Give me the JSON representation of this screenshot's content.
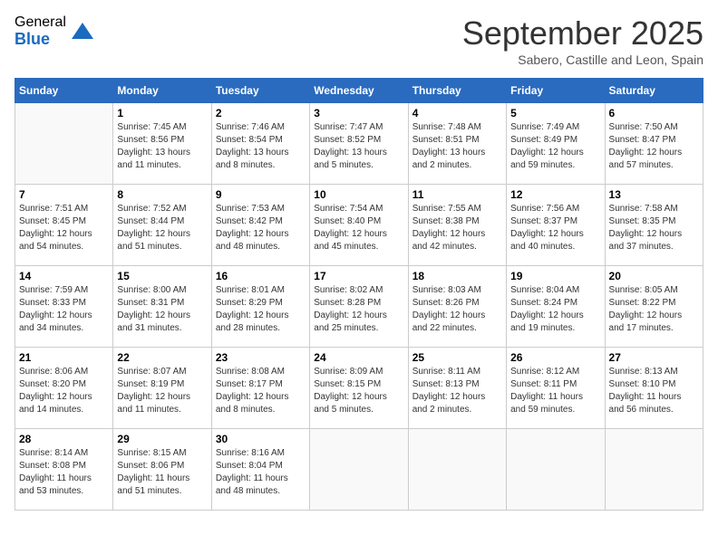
{
  "logo": {
    "general": "General",
    "blue": "Blue"
  },
  "title": "September 2025",
  "subtitle": "Sabero, Castille and Leon, Spain",
  "days_of_week": [
    "Sunday",
    "Monday",
    "Tuesday",
    "Wednesday",
    "Thursday",
    "Friday",
    "Saturday"
  ],
  "weeks": [
    [
      {
        "day": "",
        "info": ""
      },
      {
        "day": "1",
        "info": "Sunrise: 7:45 AM\nSunset: 8:56 PM\nDaylight: 13 hours\nand 11 minutes."
      },
      {
        "day": "2",
        "info": "Sunrise: 7:46 AM\nSunset: 8:54 PM\nDaylight: 13 hours\nand 8 minutes."
      },
      {
        "day": "3",
        "info": "Sunrise: 7:47 AM\nSunset: 8:52 PM\nDaylight: 13 hours\nand 5 minutes."
      },
      {
        "day": "4",
        "info": "Sunrise: 7:48 AM\nSunset: 8:51 PM\nDaylight: 13 hours\nand 2 minutes."
      },
      {
        "day": "5",
        "info": "Sunrise: 7:49 AM\nSunset: 8:49 PM\nDaylight: 12 hours\nand 59 minutes."
      },
      {
        "day": "6",
        "info": "Sunrise: 7:50 AM\nSunset: 8:47 PM\nDaylight: 12 hours\nand 57 minutes."
      }
    ],
    [
      {
        "day": "7",
        "info": "Sunrise: 7:51 AM\nSunset: 8:45 PM\nDaylight: 12 hours\nand 54 minutes."
      },
      {
        "day": "8",
        "info": "Sunrise: 7:52 AM\nSunset: 8:44 PM\nDaylight: 12 hours\nand 51 minutes."
      },
      {
        "day": "9",
        "info": "Sunrise: 7:53 AM\nSunset: 8:42 PM\nDaylight: 12 hours\nand 48 minutes."
      },
      {
        "day": "10",
        "info": "Sunrise: 7:54 AM\nSunset: 8:40 PM\nDaylight: 12 hours\nand 45 minutes."
      },
      {
        "day": "11",
        "info": "Sunrise: 7:55 AM\nSunset: 8:38 PM\nDaylight: 12 hours\nand 42 minutes."
      },
      {
        "day": "12",
        "info": "Sunrise: 7:56 AM\nSunset: 8:37 PM\nDaylight: 12 hours\nand 40 minutes."
      },
      {
        "day": "13",
        "info": "Sunrise: 7:58 AM\nSunset: 8:35 PM\nDaylight: 12 hours\nand 37 minutes."
      }
    ],
    [
      {
        "day": "14",
        "info": "Sunrise: 7:59 AM\nSunset: 8:33 PM\nDaylight: 12 hours\nand 34 minutes."
      },
      {
        "day": "15",
        "info": "Sunrise: 8:00 AM\nSunset: 8:31 PM\nDaylight: 12 hours\nand 31 minutes."
      },
      {
        "day": "16",
        "info": "Sunrise: 8:01 AM\nSunset: 8:29 PM\nDaylight: 12 hours\nand 28 minutes."
      },
      {
        "day": "17",
        "info": "Sunrise: 8:02 AM\nSunset: 8:28 PM\nDaylight: 12 hours\nand 25 minutes."
      },
      {
        "day": "18",
        "info": "Sunrise: 8:03 AM\nSunset: 8:26 PM\nDaylight: 12 hours\nand 22 minutes."
      },
      {
        "day": "19",
        "info": "Sunrise: 8:04 AM\nSunset: 8:24 PM\nDaylight: 12 hours\nand 19 minutes."
      },
      {
        "day": "20",
        "info": "Sunrise: 8:05 AM\nSunset: 8:22 PM\nDaylight: 12 hours\nand 17 minutes."
      }
    ],
    [
      {
        "day": "21",
        "info": "Sunrise: 8:06 AM\nSunset: 8:20 PM\nDaylight: 12 hours\nand 14 minutes."
      },
      {
        "day": "22",
        "info": "Sunrise: 8:07 AM\nSunset: 8:19 PM\nDaylight: 12 hours\nand 11 minutes."
      },
      {
        "day": "23",
        "info": "Sunrise: 8:08 AM\nSunset: 8:17 PM\nDaylight: 12 hours\nand 8 minutes."
      },
      {
        "day": "24",
        "info": "Sunrise: 8:09 AM\nSunset: 8:15 PM\nDaylight: 12 hours\nand 5 minutes."
      },
      {
        "day": "25",
        "info": "Sunrise: 8:11 AM\nSunset: 8:13 PM\nDaylight: 12 hours\nand 2 minutes."
      },
      {
        "day": "26",
        "info": "Sunrise: 8:12 AM\nSunset: 8:11 PM\nDaylight: 11 hours\nand 59 minutes."
      },
      {
        "day": "27",
        "info": "Sunrise: 8:13 AM\nSunset: 8:10 PM\nDaylight: 11 hours\nand 56 minutes."
      }
    ],
    [
      {
        "day": "28",
        "info": "Sunrise: 8:14 AM\nSunset: 8:08 PM\nDaylight: 11 hours\nand 53 minutes."
      },
      {
        "day": "29",
        "info": "Sunrise: 8:15 AM\nSunset: 8:06 PM\nDaylight: 11 hours\nand 51 minutes."
      },
      {
        "day": "30",
        "info": "Sunrise: 8:16 AM\nSunset: 8:04 PM\nDaylight: 11 hours\nand 48 minutes."
      },
      {
        "day": "",
        "info": ""
      },
      {
        "day": "",
        "info": ""
      },
      {
        "day": "",
        "info": ""
      },
      {
        "day": "",
        "info": ""
      }
    ]
  ]
}
